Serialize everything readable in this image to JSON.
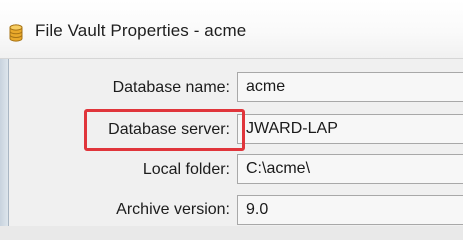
{
  "window": {
    "title": "File Vault Properties - acme",
    "icon": "database-icon"
  },
  "fields": [
    {
      "label": "Database name:",
      "value": "acme"
    },
    {
      "label": "Database server:",
      "value": "JWARD-LAP"
    },
    {
      "label": "Local folder:",
      "value": "C:\\acme\\"
    },
    {
      "label": "Archive version:",
      "value": "9.0"
    }
  ],
  "highlight": {
    "target": "Database server:",
    "color": "#e0353b"
  }
}
